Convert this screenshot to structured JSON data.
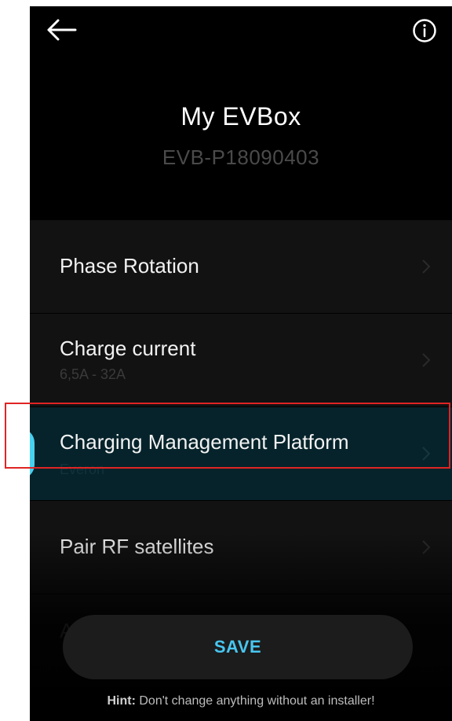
{
  "header": {
    "title": "My EVBox",
    "serial": "EVB-P18090403",
    "back_icon": "arrow-left-icon",
    "info_icon": "info-circle-icon"
  },
  "list": {
    "items": [
      {
        "title": "Phase Rotation",
        "subtitle": ""
      },
      {
        "title": "Charge current",
        "subtitle": "6,5A - 32A"
      },
      {
        "title": "Charging Management Platform",
        "subtitle": "Everon"
      },
      {
        "title": "Pair RF satellites",
        "subtitle": ""
      },
      {
        "title": "AF",
        "subtitle": ""
      }
    ]
  },
  "footer": {
    "save_label": "SAVE",
    "hint_label": "Hint:",
    "hint_text": "Don't change anything without an installer!"
  },
  "colors": {
    "accent": "#48c6f0",
    "selected_row": "#06232b",
    "row_bg": "#121212",
    "highlight_box": "#e02424"
  }
}
